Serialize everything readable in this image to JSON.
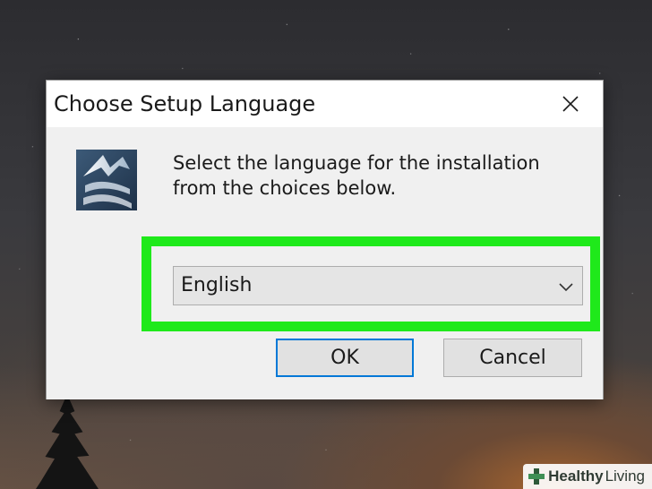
{
  "dialog": {
    "title": "Choose Setup Language",
    "instruction": "Select the language for the installation from the choices below.",
    "language_select": {
      "selected": "English"
    },
    "ok_label": "OK",
    "cancel_label": "Cancel",
    "close_icon": "close-icon",
    "app_icon": "setup-app-icon"
  },
  "highlight": {
    "color": "#1fe91b"
  },
  "accent_color": "#0078d7",
  "watermark": {
    "brand_bold": "Healthy",
    "brand_rest": " Living"
  }
}
